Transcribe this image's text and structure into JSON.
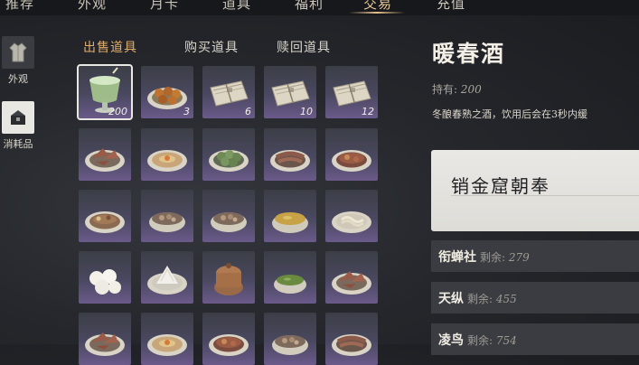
{
  "top_nav": {
    "tabs": [
      "推荐",
      "外观",
      "月卡",
      "道具",
      "福利",
      "交易",
      "充值"
    ],
    "active_index": 5
  },
  "sidebar": {
    "items": [
      {
        "label": "外观",
        "icon": "robe-icon",
        "active": false
      },
      {
        "label": "消耗品",
        "icon": "consumable-icon",
        "active": true
      }
    ]
  },
  "subtabs": {
    "items": [
      "出售道具",
      "购买道具",
      "赎回道具"
    ],
    "active_index": 0
  },
  "inventory": {
    "rows": [
      [
        {
          "icon": "wine-cup-icon",
          "qty": "200",
          "selected": true
        },
        {
          "icon": "meatballs-icon",
          "qty": "3"
        },
        {
          "icon": "paper-bundle-icon",
          "qty": "6"
        },
        {
          "icon": "paper-bundle-icon",
          "qty": "10"
        },
        {
          "icon": "paper-bundle-icon",
          "qty": "12"
        }
      ],
      [
        {
          "icon": "dish-meat-icon",
          "qty": ""
        },
        {
          "icon": "dish-plate-icon",
          "qty": ""
        },
        {
          "icon": "dish-greens-icon",
          "qty": ""
        },
        {
          "icon": "dish-sliced-icon",
          "qty": ""
        },
        {
          "icon": "dish-stew-icon",
          "qty": ""
        }
      ],
      [
        {
          "icon": "dish-mixed-icon",
          "qty": ""
        },
        {
          "icon": "dish-bowl-icon",
          "qty": ""
        },
        {
          "icon": "dish-bowl-icon",
          "qty": ""
        },
        {
          "icon": "soup-bowl-icon",
          "qty": ""
        },
        {
          "icon": "dish-noodles-icon",
          "qty": ""
        }
      ],
      [
        {
          "icon": "buns-icon",
          "qty": ""
        },
        {
          "icon": "rice-mound-icon",
          "qty": ""
        },
        {
          "icon": "clay-pot-icon",
          "qty": ""
        },
        {
          "icon": "tea-bowl-icon",
          "qty": ""
        },
        {
          "icon": "dish-meat-icon",
          "qty": ""
        }
      ],
      [
        {
          "icon": "dish-meat-icon",
          "qty": ""
        },
        {
          "icon": "dish-plate-icon",
          "qty": ""
        },
        {
          "icon": "dish-stew-icon",
          "qty": ""
        },
        {
          "icon": "dish-bowl-icon",
          "qty": ""
        },
        {
          "icon": "dish-sliced-icon",
          "qty": ""
        }
      ]
    ]
  },
  "detail": {
    "item_name": "暖春酒",
    "owned_label": "持有:",
    "owned_value": "200",
    "description": "冬酿春熟之酒，饮用后会在3秒内缓",
    "seller_name": "销金窟朝奉",
    "sellers": [
      {
        "name": "衔蝉社",
        "remain_label": "剩余:",
        "remain_value": "279"
      },
      {
        "name": "天纵",
        "remain_label": "剩余:",
        "remain_value": "455"
      },
      {
        "name": "凌鸟",
        "remain_label": "剩余:",
        "remain_value": "754"
      }
    ]
  },
  "colors": {
    "active_tab": "#e7c899",
    "active_subtab": "#e1ad6b",
    "slot_gradient_bottom": "#6a5a8a"
  }
}
